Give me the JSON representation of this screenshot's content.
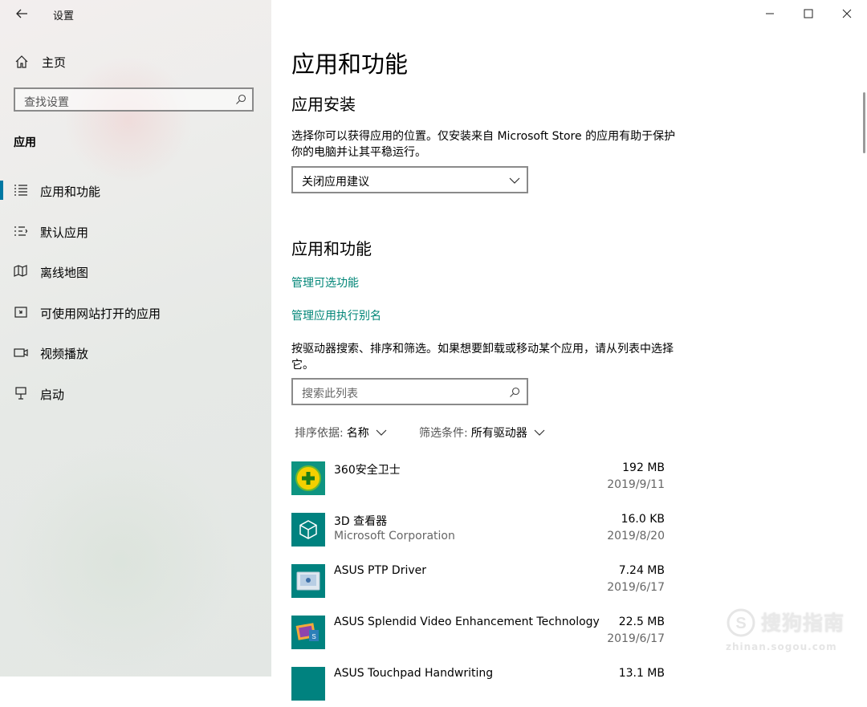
{
  "window": {
    "title": "设置",
    "buttons": {
      "minimize_icon": "minimize-icon",
      "maximize_icon": "maximize-icon",
      "close_icon": "close-icon"
    }
  },
  "sidebar": {
    "home_label": "主页",
    "search_placeholder": "查找设置",
    "section_title": "应用",
    "items": [
      {
        "label": "应用和功能",
        "icon": "apps-features-icon",
        "selected": true
      },
      {
        "label": "默认应用",
        "icon": "default-apps-icon",
        "selected": false
      },
      {
        "label": "离线地图",
        "icon": "offline-maps-icon",
        "selected": false
      },
      {
        "label": "可使用网站打开的应用",
        "icon": "apps-for-websites-icon",
        "selected": false
      },
      {
        "label": "视频播放",
        "icon": "video-playback-icon",
        "selected": false
      },
      {
        "label": "启动",
        "icon": "startup-icon",
        "selected": false
      }
    ]
  },
  "main": {
    "page_title": "应用和功能",
    "install": {
      "heading": "应用安装",
      "description": "选择你可以获得应用的位置。仅安装来自 Microsoft Store 的应用有助于保护你的电脑并让其平稳运行。",
      "dropdown_value": "关闭应用建议"
    },
    "apps": {
      "heading": "应用和功能",
      "link_optional": "管理可选功能",
      "link_alias": "管理应用执行别名",
      "description": "按驱动器搜索、排序和筛选。如果想要卸载或移动某个应用，请从列表中选择它。",
      "search_placeholder": "搜索此列表",
      "sort_key": "排序依据:",
      "sort_value": "名称",
      "filter_key": "筛选条件:",
      "filter_value": "所有驱动器",
      "list": [
        {
          "name": "360安全卫士",
          "publisher": "",
          "size": "192 MB",
          "date": "2019/9/11",
          "icon": "360-safeguard-icon"
        },
        {
          "name": "3D 查看器",
          "publisher": "Microsoft Corporation",
          "size": "16.0 KB",
          "date": "2019/8/20",
          "icon": "3d-viewer-icon"
        },
        {
          "name": "ASUS PTP Driver",
          "publisher": "",
          "size": "7.24 MB",
          "date": "2019/6/17",
          "icon": "asus-ptp-icon"
        },
        {
          "name": "ASUS Splendid Video Enhancement Technology",
          "publisher": "",
          "size": "22.5 MB",
          "date": "2019/6/17",
          "icon": "asus-splendid-icon"
        },
        {
          "name": "ASUS Touchpad Handwriting",
          "publisher": "",
          "size": "13.1 MB",
          "date": "",
          "icon": "asus-touchpad-icon"
        }
      ]
    }
  },
  "watermark": {
    "name": "搜狗指南",
    "url": "zhinan.sogou.com"
  },
  "colors": {
    "accent": "#008577",
    "selection_bar": "#0078a3",
    "app_tile": "#00827f"
  }
}
